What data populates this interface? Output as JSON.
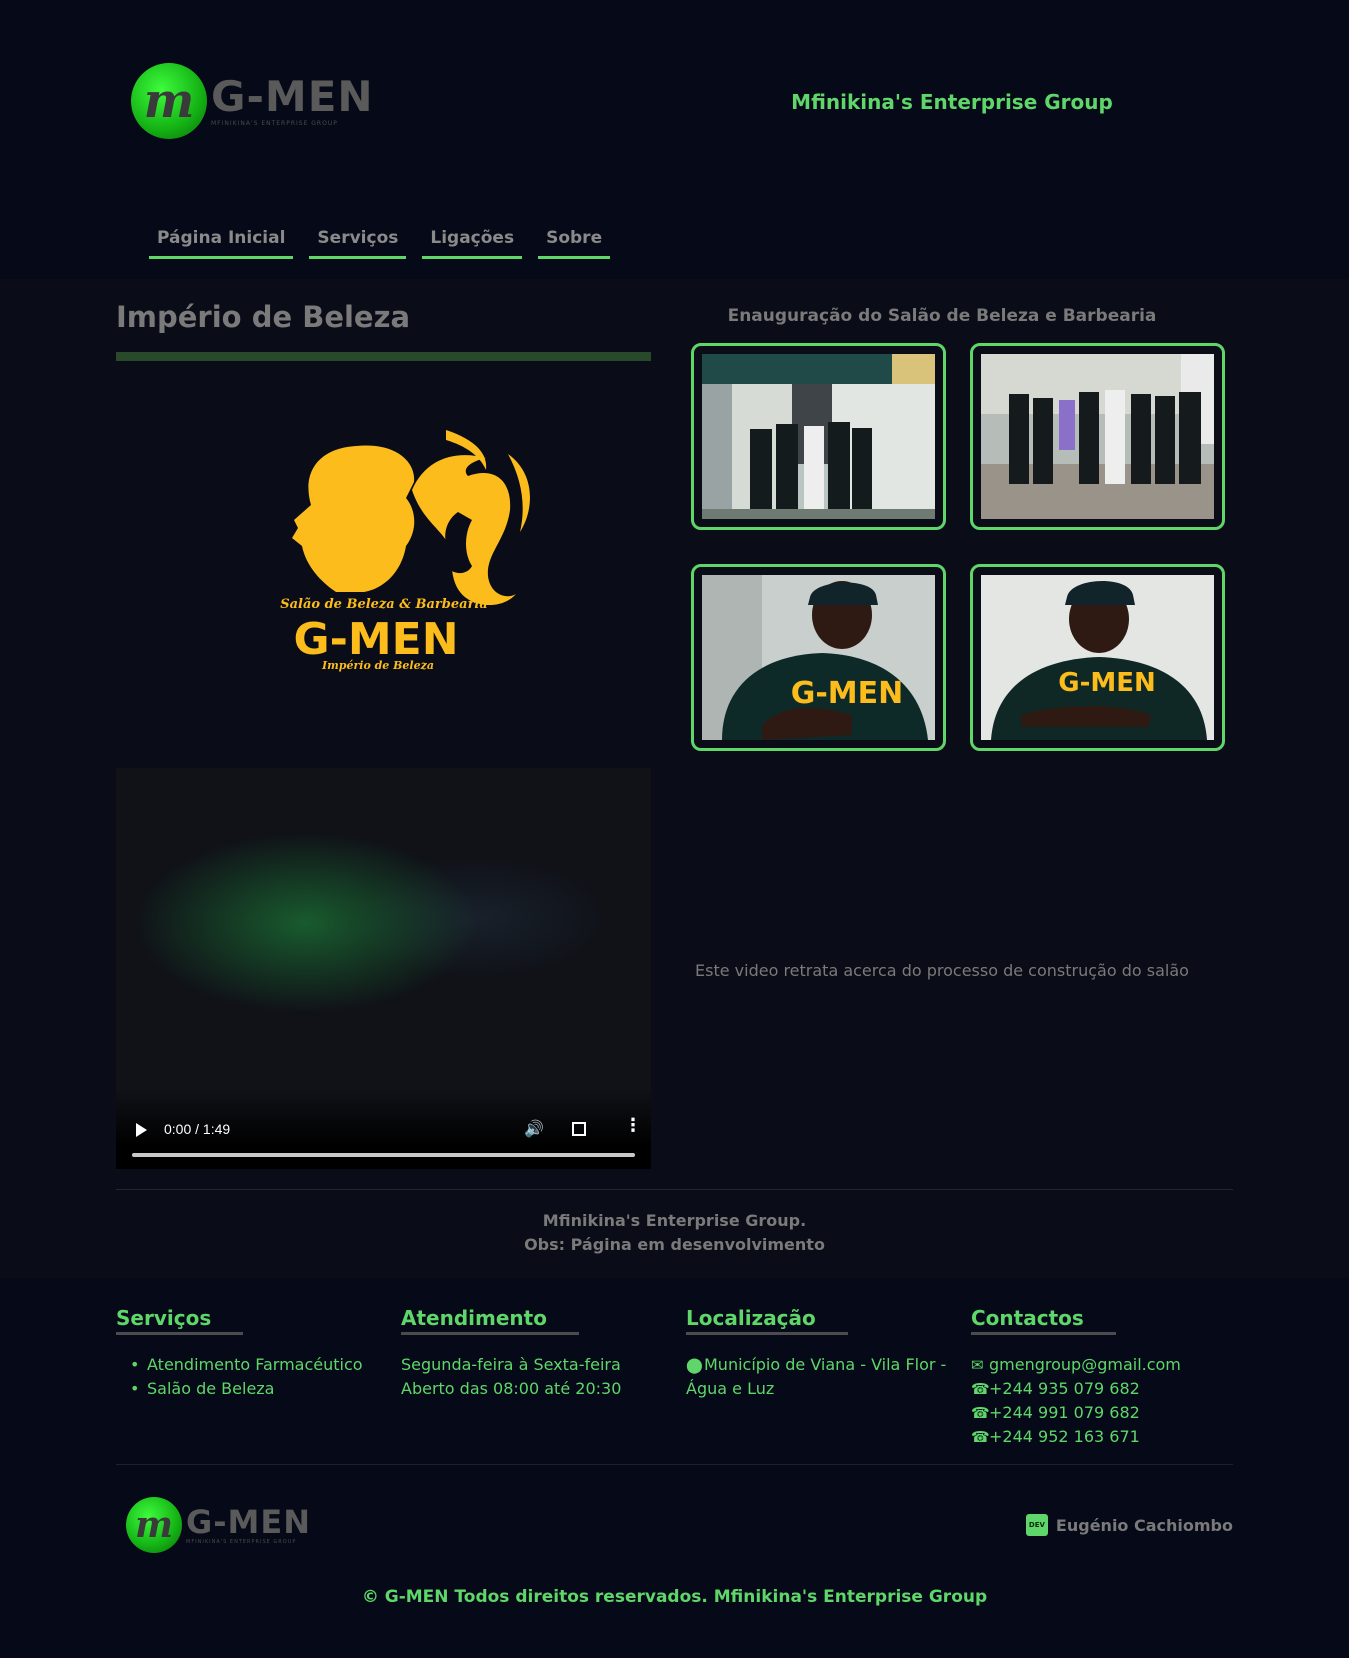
{
  "colors": {
    "accent": "#5fd66a",
    "background": "#070a18",
    "emblem": "#fbbc1c"
  },
  "header": {
    "logo": {
      "word": "G-MEN",
      "tagline": "MFINIKINA'S ENTERPRISE GROUP",
      "monogram": "m"
    },
    "enterprise_title": "Mfinikina's Enterprise Group"
  },
  "nav": {
    "items": [
      {
        "label": "Página Inicial"
      },
      {
        "label": "Serviços"
      },
      {
        "label": "Ligações"
      },
      {
        "label": "Sobre"
      }
    ]
  },
  "main": {
    "title": "Império de Beleza",
    "emblem": {
      "line1": "Salão de Beleza & Barbearia",
      "brand": "G-MEN",
      "line2": "Império de Beleza"
    },
    "video": {
      "time": "0:00 / 1:49",
      "description": "Este video retrata acerca do processo de construção do salão"
    },
    "gallery": {
      "title": "Enauguração do Salão de Beleza e Barbearia",
      "photos": [
        {
          "alt": "Equipa em frente ao salão"
        },
        {
          "alt": "Grupo na inauguração"
        },
        {
          "alt": "Membro com camisola G-MEN"
        },
        {
          "alt": "Membro sorridente com camisola G-MEN"
        }
      ]
    },
    "note": {
      "line1": "Mfinikina's Enterprise Group.",
      "line2": "Obs: Página em desenvolvimento"
    }
  },
  "footer": {
    "services": {
      "title": "Serviços",
      "items": [
        "Atendimento Farmacéutico",
        "Salão de Beleza"
      ]
    },
    "hours": {
      "title": "Atendimento",
      "line1": "Segunda-feira à Sexta-feira",
      "line2": "Aberto das 08:00 até 20:30"
    },
    "location": {
      "title": "Localização",
      "address": "Município de Viana - Vila Flor - Água e Luz",
      "icon": "map-marker-icon"
    },
    "contacts": {
      "title": "Contactos",
      "email": "gmengroup@gmail.com",
      "phones": [
        "+244 935 079 682",
        "+244 991 079 682",
        "+244 952 163 671"
      ]
    },
    "developer": {
      "badge": "DEV",
      "name": "Eugénio Cachiombo"
    },
    "copyright": "© G-MEN Todos direitos reservados. Mfinikina's Enterprise Group"
  }
}
